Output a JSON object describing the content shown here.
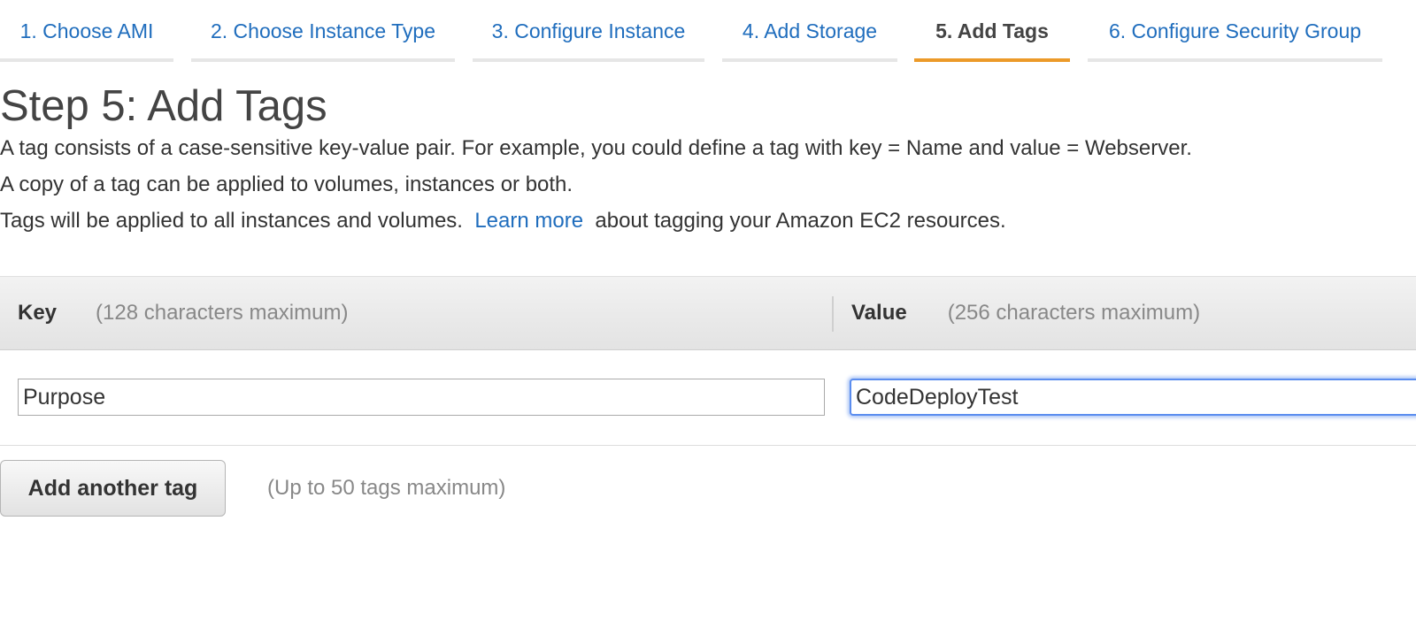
{
  "wizard": {
    "tabs": [
      {
        "label": "1. Choose AMI",
        "active": false
      },
      {
        "label": "2. Choose Instance Type",
        "active": false
      },
      {
        "label": "3. Configure Instance",
        "active": false
      },
      {
        "label": "4. Add Storage",
        "active": false
      },
      {
        "label": "5. Add Tags",
        "active": true
      },
      {
        "label": "6. Configure Security Group",
        "active": false
      }
    ]
  },
  "page": {
    "title": "Step 5: Add Tags",
    "description_line1": "A tag consists of a case-sensitive key-value pair. For example, you could define a tag with key = Name and value = Webserver.",
    "description_line2": "A copy of a tag can be applied to volumes, instances or both.",
    "description_line3_before": "Tags will be applied to all instances and volumes.",
    "learn_more_label": "Learn more",
    "description_line3_after": "about tagging your Amazon EC2 resources."
  },
  "tag_table": {
    "key_header": "Key",
    "key_hint": "(128 characters maximum)",
    "value_header": "Value",
    "value_hint": "(256 characters maximum)",
    "rows": [
      {
        "key": "Purpose",
        "value": "CodeDeployTest"
      }
    ]
  },
  "actions": {
    "add_tag_label": "Add another tag",
    "tag_limit_text": "(Up to 50 tags maximum)"
  },
  "colors": {
    "link": "#1f6dbd",
    "active_tab_underline": "#ec9a29",
    "focus_ring": "#5b8def"
  }
}
